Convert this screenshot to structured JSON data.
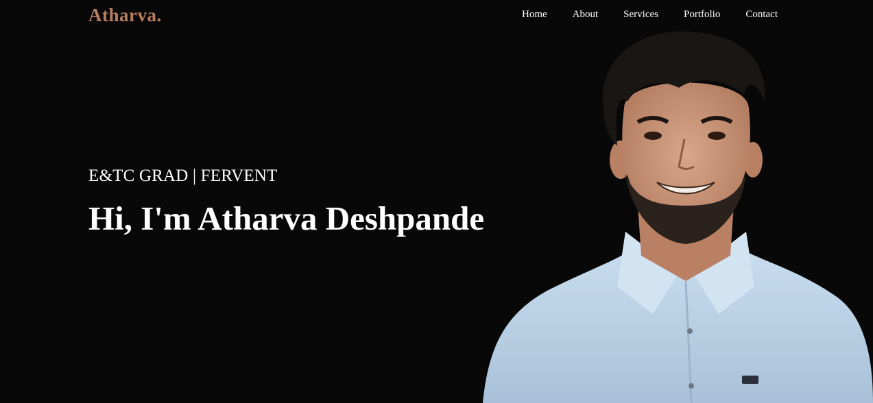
{
  "header": {
    "logo_text": "Atharva.",
    "nav": [
      {
        "label": "Home"
      },
      {
        "label": "About"
      },
      {
        "label": "Services"
      },
      {
        "label": "Portfolio"
      },
      {
        "label": "Contact"
      }
    ]
  },
  "hero": {
    "subtitle": "E&TC GRAD | FERVENT",
    "headline": "Hi, I'm Atharva Deshpande"
  },
  "colors": {
    "background": "#080808",
    "logo": "#b87e5f",
    "text": "#ffffff",
    "shirt": "#b9cfe3"
  }
}
